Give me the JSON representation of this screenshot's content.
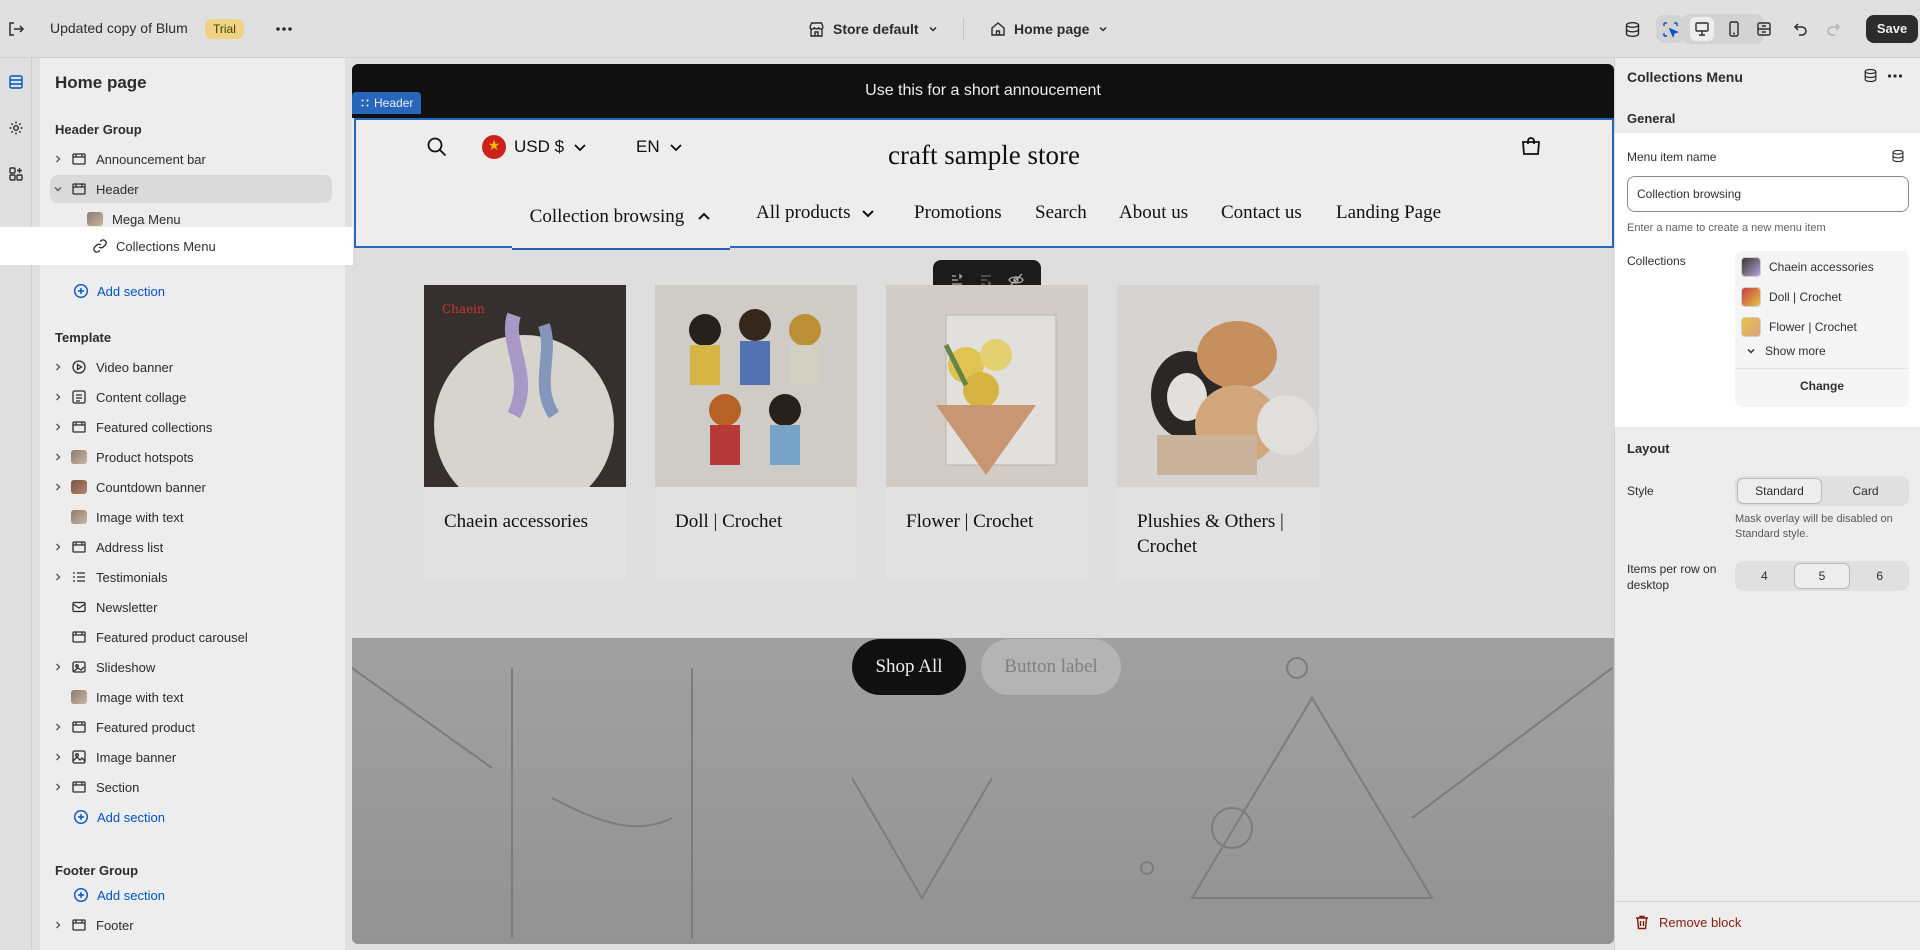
{
  "topbar": {
    "store_title": "Updated copy of Blum",
    "trial_badge": "Trial",
    "theme_dropdown": "Store default",
    "page_dropdown": "Home page",
    "save_label": "Save"
  },
  "left_panel": {
    "title": "Home page",
    "header_group_label": "Header Group",
    "header_group_items": [
      {
        "label": "Announcement bar"
      },
      {
        "label": "Header"
      },
      {
        "label": "Mega Menu"
      },
      {
        "label": "Collections Menu"
      }
    ],
    "add_section_label": "Add section",
    "template_label": "Template",
    "template_items": [
      {
        "label": "Video banner"
      },
      {
        "label": "Content collage"
      },
      {
        "label": "Featured collections"
      },
      {
        "label": "Product hotspots"
      },
      {
        "label": "Countdown banner"
      },
      {
        "label": "Image with text"
      },
      {
        "label": "Address list"
      },
      {
        "label": "Testimonials"
      },
      {
        "label": "Newsletter"
      },
      {
        "label": "Featured product carousel"
      },
      {
        "label": "Slideshow"
      },
      {
        "label": "Image with text"
      },
      {
        "label": "Featured product"
      },
      {
        "label": "Image banner"
      },
      {
        "label": "Section"
      }
    ],
    "footer_group_label": "Footer Group",
    "footer_items": [
      {
        "label": "Footer"
      }
    ]
  },
  "canvas": {
    "announcement": "Use this for a short annoucement",
    "header_tag": "Header",
    "currency": "USD $",
    "language": "EN",
    "store_name": "craft sample store",
    "nav": {
      "active": "Collection browsing",
      "items": [
        "All products",
        "Promotions",
        "Search",
        "About us",
        "Contact us",
        "Landing Page"
      ]
    },
    "collections": [
      {
        "title": "Chaein accessories"
      },
      {
        "title": "Doll | Crochet"
      },
      {
        "title": "Flower | Crochet"
      },
      {
        "title": "Plushies & Others | Crochet"
      }
    ],
    "shop_all": "Shop All",
    "button_label": "Button label"
  },
  "right_panel": {
    "title": "Collections Menu",
    "general_label": "General",
    "menu_item_name_label": "Menu item name",
    "menu_item_name_value": "Collection browsing",
    "menu_item_help": "Enter a name to create a new menu item",
    "collections_label": "Collections",
    "collections": [
      {
        "label": "Chaein accessories"
      },
      {
        "label": "Doll | Crochet"
      },
      {
        "label": "Flower | Crochet"
      }
    ],
    "show_more": "Show more",
    "change": "Change",
    "layout_label": "Layout",
    "style_label": "Style",
    "style_options": [
      "Standard",
      "Card"
    ],
    "style_selected": "Standard",
    "style_help": "Mask overlay will be disabled on Standard style.",
    "items_per_row_label": "Items per row on desktop",
    "items_per_row_options": [
      "4",
      "5",
      "6"
    ],
    "items_per_row_selected": "5",
    "remove_block": "Remove block"
  },
  "colors": {
    "accent": "#2c6ecb",
    "link": "#005bd3",
    "danger": "#8e1f0b",
    "trial_badge_bg": "#ffe48d"
  }
}
